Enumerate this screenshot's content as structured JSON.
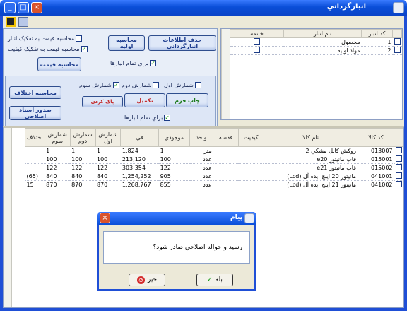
{
  "window": {
    "title": "انبارگرداني"
  },
  "warehouses": {
    "headers": {
      "code": "کد انبار",
      "name": "نام انبار",
      "close": "خاتمه"
    },
    "rows": [
      {
        "code": "1",
        "name": "محصول"
      },
      {
        "code": "2",
        "name": "مواد اوليه"
      }
    ]
  },
  "top_buttons": {
    "delete_info": "حذف اطلاعات انبارگرداني",
    "calc_initial": "محاسبه اوليه",
    "calc_price": "محاسبه قيمت",
    "all_warehouses": "براي تمام انبارها"
  },
  "top_checks": {
    "price_by_warehouse": "محاسبه قيمت به تفکيک انبار",
    "price_by_quality": "محاسبه قيمت به تفکيک کيفيت"
  },
  "count_panel": {
    "count1": "شمارش اول",
    "count2": "شمارش دوم",
    "count3": "شمارش سوم",
    "print_form": "چاپ فرم",
    "complete": "تکميل",
    "clear": "پاک کردن",
    "all_warehouses": "براي تمام انبارها",
    "calc_diff": "محاسبه اختلاف",
    "issue_corrective": "صدور اسناد اصلاحي"
  },
  "items": {
    "headers": [
      "کد کالا",
      "نام کالا",
      "کيفيت",
      "قفسه",
      "واحد",
      "موجودي",
      "في",
      "شمارش اول",
      "شمارش دوم",
      "شمارش سوم",
      "اختلاف"
    ],
    "rows": [
      {
        "code": "013007",
        "name": "روکش کابل مشکي 2",
        "unit": "متر",
        "stock": "1",
        "price": "1,824",
        "c1": "1",
        "c2": "1",
        "c3": "1",
        "diff": ""
      },
      {
        "code": "015001",
        "name": "قاب مانيتور e20",
        "unit": "عدد",
        "stock": "100",
        "price": "213,120",
        "c1": "100",
        "c2": "100",
        "c3": "100",
        "diff": ""
      },
      {
        "code": "015002",
        "name": "قاب مانيتور e21",
        "unit": "عدد",
        "stock": "122",
        "price": "303,354",
        "c1": "122",
        "c2": "122",
        "c3": "122",
        "diff": ""
      },
      {
        "code": "041001",
        "name": "مانيتور 20 اينچ ايده آل (Lcd)",
        "unit": "عدد",
        "stock": "905",
        "price": "1,254,252",
        "c1": "840",
        "c2": "840",
        "c3": "840",
        "diff": "(65)"
      },
      {
        "code": "041002",
        "name": "مانيتور 21 اينچ ايده آل (Lcd)",
        "unit": "عدد",
        "stock": "855",
        "price": "1,268,767",
        "c1": "870",
        "c2": "870",
        "c3": "870",
        "diff": "15"
      }
    ]
  },
  "dialog": {
    "title": "پيام",
    "message": "رسيد و حواله اصلاحي صادر شود؟",
    "yes": "بله",
    "no": "خير"
  }
}
